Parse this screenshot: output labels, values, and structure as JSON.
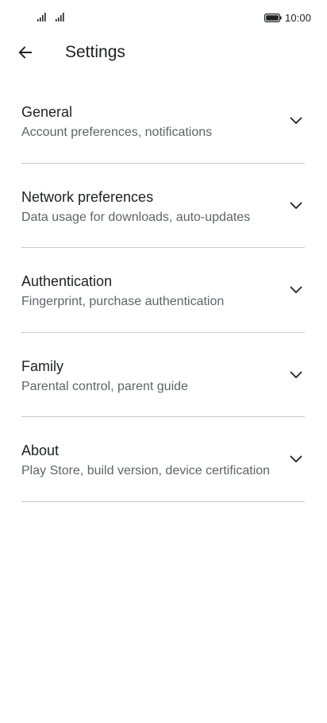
{
  "status_bar": {
    "time": "10:00",
    "icons": [
      "signal-icon",
      "signal-icon",
      "battery-icon"
    ]
  },
  "header": {
    "back_icon": "back-arrow-icon",
    "title": "Settings"
  },
  "settings": [
    {
      "title": "General",
      "subtitle": "Account preferences, notifications",
      "icon": "chevron-down-icon"
    },
    {
      "title": "Network preferences",
      "subtitle": "Data usage for downloads, auto-updates",
      "icon": "chevron-down-icon"
    },
    {
      "title": "Authentication",
      "subtitle": "Fingerprint, purchase authentication",
      "icon": "chevron-down-icon"
    },
    {
      "title": "Family",
      "subtitle": "Parental control, parent guide",
      "icon": "chevron-down-icon"
    },
    {
      "title": "About",
      "subtitle": "Play Store, build version, device certification",
      "icon": "chevron-down-icon"
    }
  ],
  "colors": {
    "text_primary": "#202124",
    "text_secondary": "#5f6368",
    "divider": "#c9c9c9"
  }
}
